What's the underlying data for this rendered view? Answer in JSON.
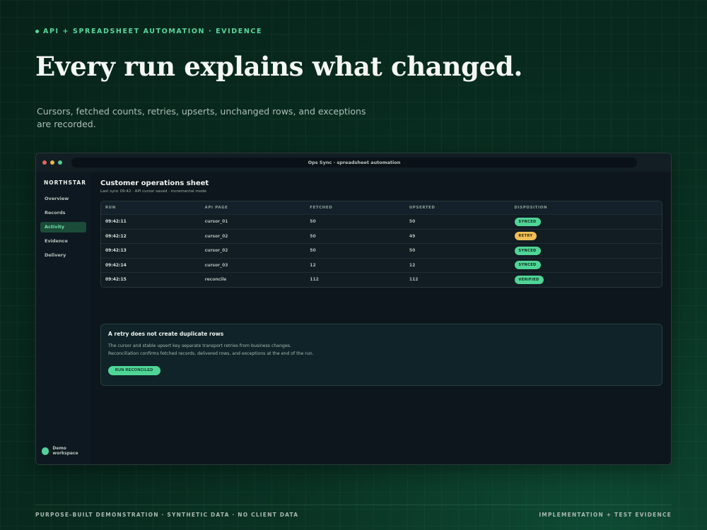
{
  "eyebrow": "API + SPREADSHEET AUTOMATION · EVIDENCE",
  "hero": {
    "title": "Every run explains what changed.",
    "subtitle": "Cursors, fetched counts, retries, upserts, unchanged rows, and exceptions are recorded."
  },
  "window": {
    "title": "Ops Sync · spreadsheet automation",
    "brand": "NORTHSTAR",
    "nav": [
      "Overview",
      "Records",
      "Activity",
      "Evidence",
      "Delivery"
    ],
    "active_nav": "Activity",
    "workspace": "Demo workspace",
    "sheet": {
      "title": "Customer operations sheet",
      "meta": "Last sync 09:42 · API cursor saved · incremental mode"
    },
    "table": {
      "headers": [
        "RUN",
        "API PAGE",
        "FETCHED",
        "UPSERTED",
        "DISPOSITION"
      ],
      "rows": [
        {
          "run": "09:42:11",
          "page": "cursor_01",
          "fetched": "50",
          "upserted": "50",
          "disposition": "SYNCED",
          "tone": "green"
        },
        {
          "run": "09:42:12",
          "page": "cursor_02",
          "fetched": "50",
          "upserted": "49",
          "disposition": "RETRY",
          "tone": "yellow"
        },
        {
          "run": "09:42:13",
          "page": "cursor_02",
          "fetched": "50",
          "upserted": "50",
          "disposition": "SYNCED",
          "tone": "green"
        },
        {
          "run": "09:42:14",
          "page": "cursor_03",
          "fetched": "12",
          "upserted": "12",
          "disposition": "SYNCED",
          "tone": "green"
        },
        {
          "run": "09:42:15",
          "page": "reconcile",
          "fetched": "112",
          "upserted": "112",
          "disposition": "VERIFIED",
          "tone": "green"
        }
      ]
    },
    "info": {
      "title": "A retry does not create duplicate rows",
      "body": "The cursor and stable upsert key separate transport retries from business changes. Reconciliation confirms fetched records, delivered rows, and exceptions at the end of the run.",
      "button": "RUN RECONCILED"
    }
  },
  "footer": {
    "left": "PURPOSE-BUILT DEMONSTRATION · SYNTHETIC DATA · NO CLIENT DATA",
    "right": "IMPLEMENTATION + TEST EVIDENCE"
  },
  "colors": {
    "accent": "#57d79c",
    "badge_green": "#4fd596",
    "badge_yellow": "#efbe56"
  }
}
